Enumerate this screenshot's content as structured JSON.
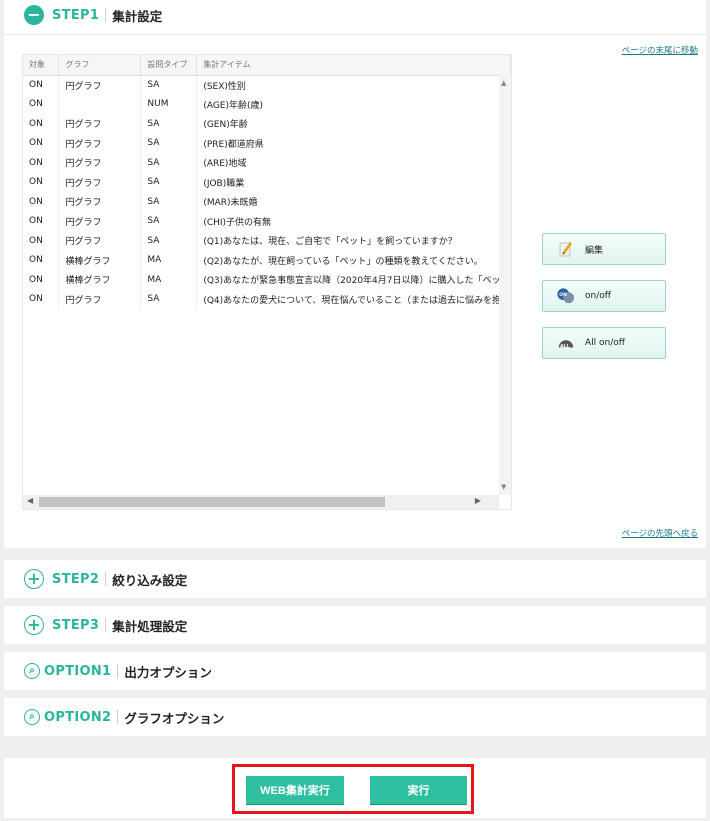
{
  "step1": {
    "label": "STEP1",
    "title": "集計設定",
    "jump_to_bottom": "ページの末尾に移動",
    "jump_to_top": "ページの先頭へ戻る",
    "table": {
      "headers": [
        "対象",
        "グラフ",
        "設問タイプ",
        "集計アイテム"
      ],
      "rows": [
        {
          "target": "ON",
          "graph": "円グラフ",
          "type": "SA",
          "item": "(SEX)性別"
        },
        {
          "target": "ON",
          "graph": "",
          "type": "NUM",
          "item": "(AGE)年齢(歳)"
        },
        {
          "target": "ON",
          "graph": "円グラフ",
          "type": "SA",
          "item": "(GEN)年齢"
        },
        {
          "target": "ON",
          "graph": "円グラフ",
          "type": "SA",
          "item": "(PRE)都道府県"
        },
        {
          "target": "ON",
          "graph": "円グラフ",
          "type": "SA",
          "item": "(ARE)地域"
        },
        {
          "target": "ON",
          "graph": "円グラフ",
          "type": "SA",
          "item": "(JOB)職業"
        },
        {
          "target": "ON",
          "graph": "円グラフ",
          "type": "SA",
          "item": "(MAR)未既婚"
        },
        {
          "target": "ON",
          "graph": "円グラフ",
          "type": "SA",
          "item": "(CHI)子供の有無"
        },
        {
          "target": "ON",
          "graph": "円グラフ",
          "type": "SA",
          "item": "(Q1)あなたは、現在、ご自宅で「ペット」を飼っていますか？"
        },
        {
          "target": "ON",
          "graph": "横棒グラフ",
          "type": "MA",
          "item": "(Q2)あなたが、現在飼っている「ペット」の種類を教えてください。"
        },
        {
          "target": "ON",
          "graph": "横棒グラフ",
          "type": "MA",
          "item": "(Q3)あなたが緊急事態宣言以降（2020年4月7日以降）に購入した「ペッ"
        },
        {
          "target": "ON",
          "graph": "円グラフ",
          "type": "SA",
          "item": "(Q4)あなたの愛犬について、現在悩んでいること（または過去に悩みを抱"
        }
      ]
    },
    "buttons": {
      "edit": "編集",
      "onoff": "on/off",
      "all_onoff": "All on/off"
    }
  },
  "step2": {
    "label": "STEP2",
    "title": "絞り込み設定"
  },
  "step3": {
    "label": "STEP3",
    "title": "集計処理設定"
  },
  "option1": {
    "label": "OPTION1",
    "title": "出力オプション"
  },
  "option2": {
    "label": "OPTION2",
    "title": "グラフオプション"
  },
  "actions": {
    "web_run": "WEB集計実行",
    "run": "実行"
  },
  "colors": {
    "accent": "#2bb59a",
    "highlight_frame": "#e8141c"
  }
}
